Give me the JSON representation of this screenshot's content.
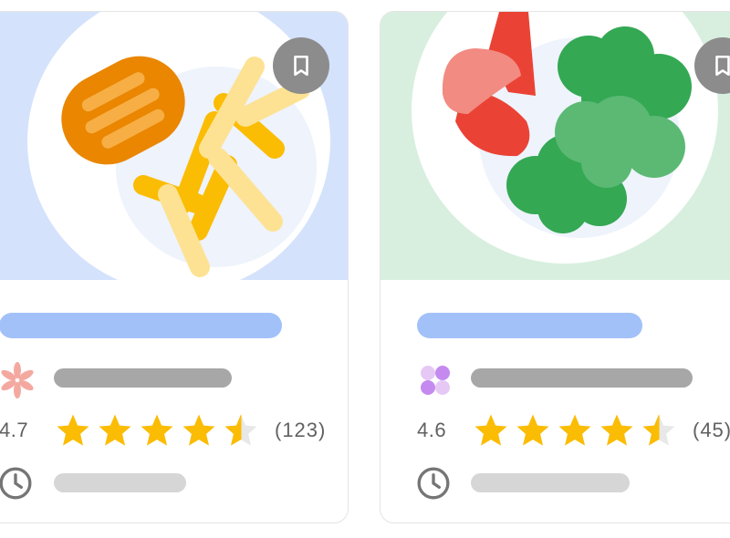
{
  "colors": {
    "hero_blue": "#d4e2fc",
    "hero_green": "#d8efdf",
    "star_gold": "#fbbc04",
    "star_empty": "#e8e8e8",
    "title_placeholder": "#a2c1f8",
    "source_placeholder": "#a7a7a7",
    "time_placeholder": "#d6d6d6",
    "save_button": "#8c8c8c"
  },
  "cards": [
    {
      "image": "plate with sausage and fries",
      "source_icon": "flower-icon",
      "rating": "4.7",
      "rating_value": 4.5,
      "review_count": "(123)",
      "time_icon": "clock-icon",
      "save_icon": "bookmark-icon"
    },
    {
      "image": "plate with tomatoes and broccoli",
      "source_icon": "dots-grid-icon",
      "rating": "4.6",
      "rating_value": 4.5,
      "review_count": "(45)",
      "time_icon": "clock-icon",
      "save_icon": "bookmark-icon"
    }
  ]
}
